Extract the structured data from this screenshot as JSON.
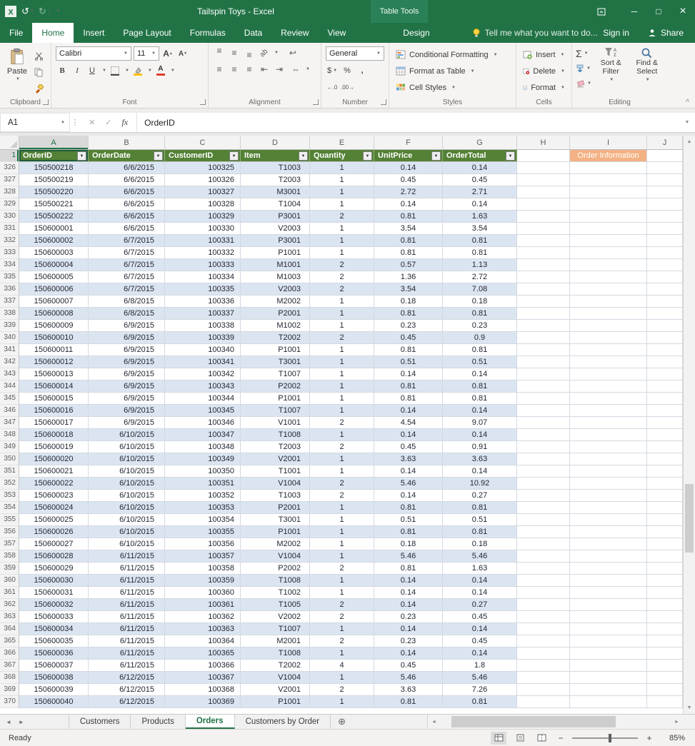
{
  "title_bar": {
    "title": "Tailspin Toys - Excel",
    "context_label": "Table Tools"
  },
  "icons": {
    "undo": "↺",
    "redo": "↻",
    "dropdown": "▼",
    "minimize": "─",
    "maximize": "□",
    "close": "×",
    "cancel": "✕",
    "enter": "✓",
    "insert_function": "fx",
    "vdots": "⋮",
    "expand_formula": "▼",
    "align_lines": "≡",
    "wrap": "↩",
    "orientation": "ab",
    "indent_dec": "⇤",
    "indent_inc": "⇥",
    "dec_decimal": "←.0",
    "inc_decimal": ".00→",
    "currency": "$",
    "percent": "%",
    "comma": ",",
    "autosum": "Σ",
    "collapse_ribbon": "^",
    "scroll_up": "▲",
    "scroll_down": "▼",
    "scroll_left": "◄",
    "scroll_right": "►",
    "prev_sheet": "◄",
    "next_sheet": "►",
    "add_sheet": "⊕",
    "zoom_out": "−",
    "zoom_in": "+",
    "increase_font": "▲",
    "decrease_font": "▼",
    "grow_a": "A",
    "shrink_a": "A",
    "font_color_a": "A",
    "merge": "⇔"
  },
  "ribbon": {
    "tabs": [
      {
        "label": "File",
        "file": true
      },
      {
        "label": "Home",
        "active": true
      },
      {
        "label": "Insert"
      },
      {
        "label": "Page Layout"
      },
      {
        "label": "Formulas"
      },
      {
        "label": "Data"
      },
      {
        "label": "Review"
      },
      {
        "label": "View"
      },
      {
        "label": "Design",
        "contextual": true
      }
    ],
    "tell_me": "Tell me what you want to do...",
    "sign_in": "Sign in",
    "share": "Share",
    "clipboard": {
      "label": "Clipboard",
      "paste": "Paste"
    },
    "font": {
      "label": "Font",
      "font_name": "Calibri",
      "font_size": "11",
      "bold": "B",
      "italic": "I",
      "underline": "U"
    },
    "alignment": {
      "label": "Alignment"
    },
    "number": {
      "label": "Number",
      "format": "General"
    },
    "styles": {
      "label": "Styles",
      "items": [
        "Conditional Formatting",
        "Format as Table",
        "Cell Styles"
      ]
    },
    "cells": {
      "label": "Cells",
      "items": [
        "Insert",
        "Delete",
        "Format"
      ]
    },
    "editing": {
      "label": "Editing",
      "sort_filter": "Sort & Filter",
      "find_select": "Find & Select"
    }
  },
  "formula_bar": {
    "name_box": "A1",
    "value": "OrderID"
  },
  "sheet": {
    "columns": [
      "A",
      "B",
      "C",
      "D",
      "E",
      "F",
      "G",
      "H",
      "I",
      "J"
    ],
    "selected_column": "A",
    "header_row_num": "1",
    "headers": [
      "OrderID",
      "OrderDate",
      "CustomerID",
      "Item",
      "Quantity",
      "UnitPrice",
      "OrderTotal"
    ],
    "extra_header": {
      "col": "I",
      "label": "Order Information"
    },
    "rows": [
      {
        "n": 326,
        "c": [
          "150500218",
          "6/6/2015",
          "100325",
          "T1003",
          "1",
          "0.14",
          "0.14"
        ]
      },
      {
        "n": 327,
        "c": [
          "150500219",
          "6/6/2015",
          "100326",
          "T2003",
          "1",
          "0.45",
          "0.45"
        ]
      },
      {
        "n": 328,
        "c": [
          "150500220",
          "6/6/2015",
          "100327",
          "M3001",
          "1",
          "2.72",
          "2.71"
        ]
      },
      {
        "n": 329,
        "c": [
          "150500221",
          "6/6/2015",
          "100328",
          "T1004",
          "1",
          "0.14",
          "0.14"
        ]
      },
      {
        "n": 330,
        "c": [
          "150500222",
          "6/6/2015",
          "100329",
          "P3001",
          "2",
          "0.81",
          "1.63"
        ]
      },
      {
        "n": 331,
        "c": [
          "150600001",
          "6/6/2015",
          "100330",
          "V2003",
          "1",
          "3.54",
          "3.54"
        ]
      },
      {
        "n": 332,
        "c": [
          "150600002",
          "6/7/2015",
          "100331",
          "P3001",
          "1",
          "0.81",
          "0.81"
        ]
      },
      {
        "n": 333,
        "c": [
          "150600003",
          "6/7/2015",
          "100332",
          "P1001",
          "1",
          "0.81",
          "0.81"
        ]
      },
      {
        "n": 334,
        "c": [
          "150600004",
          "6/7/2015",
          "100333",
          "M1001",
          "2",
          "0.57",
          "1.13"
        ]
      },
      {
        "n": 335,
        "c": [
          "150600005",
          "6/7/2015",
          "100334",
          "M1003",
          "2",
          "1.36",
          "2.72"
        ]
      },
      {
        "n": 336,
        "c": [
          "150600006",
          "6/7/2015",
          "100335",
          "V2003",
          "2",
          "3.54",
          "7.08"
        ]
      },
      {
        "n": 337,
        "c": [
          "150600007",
          "6/8/2015",
          "100336",
          "M2002",
          "1",
          "0.18",
          "0.18"
        ]
      },
      {
        "n": 338,
        "c": [
          "150600008",
          "6/8/2015",
          "100337",
          "P2001",
          "1",
          "0.81",
          "0.81"
        ]
      },
      {
        "n": 339,
        "c": [
          "150600009",
          "6/9/2015",
          "100338",
          "M1002",
          "1",
          "0.23",
          "0.23"
        ]
      },
      {
        "n": 340,
        "c": [
          "150600010",
          "6/9/2015",
          "100339",
          "T2002",
          "2",
          "0.45",
          "0.9"
        ]
      },
      {
        "n": 341,
        "c": [
          "150600011",
          "6/9/2015",
          "100340",
          "P1001",
          "1",
          "0.81",
          "0.81"
        ]
      },
      {
        "n": 342,
        "c": [
          "150600012",
          "6/9/2015",
          "100341",
          "T3001",
          "1",
          "0.51",
          "0.51"
        ]
      },
      {
        "n": 343,
        "c": [
          "150600013",
          "6/9/2015",
          "100342",
          "T1007",
          "1",
          "0.14",
          "0.14"
        ]
      },
      {
        "n": 344,
        "c": [
          "150600014",
          "6/9/2015",
          "100343",
          "P2002",
          "1",
          "0.81",
          "0.81"
        ]
      },
      {
        "n": 345,
        "c": [
          "150600015",
          "6/9/2015",
          "100344",
          "P1001",
          "1",
          "0.81",
          "0.81"
        ]
      },
      {
        "n": 346,
        "c": [
          "150600016",
          "6/9/2015",
          "100345",
          "T1007",
          "1",
          "0.14",
          "0.14"
        ]
      },
      {
        "n": 347,
        "c": [
          "150600017",
          "6/9/2015",
          "100346",
          "V1001",
          "2",
          "4.54",
          "9.07"
        ]
      },
      {
        "n": 348,
        "c": [
          "150600018",
          "6/10/2015",
          "100347",
          "T1008",
          "1",
          "0.14",
          "0.14"
        ]
      },
      {
        "n": 349,
        "c": [
          "150600019",
          "6/10/2015",
          "100348",
          "T2003",
          "2",
          "0.45",
          "0.91"
        ]
      },
      {
        "n": 350,
        "c": [
          "150600020",
          "6/10/2015",
          "100349",
          "V2001",
          "1",
          "3.63",
          "3.63"
        ]
      },
      {
        "n": 351,
        "c": [
          "150600021",
          "6/10/2015",
          "100350",
          "T1001",
          "1",
          "0.14",
          "0.14"
        ]
      },
      {
        "n": 352,
        "c": [
          "150600022",
          "6/10/2015",
          "100351",
          "V1004",
          "2",
          "5.46",
          "10.92"
        ]
      },
      {
        "n": 353,
        "c": [
          "150600023",
          "6/10/2015",
          "100352",
          "T1003",
          "2",
          "0.14",
          "0.27"
        ]
      },
      {
        "n": 354,
        "c": [
          "150600024",
          "6/10/2015",
          "100353",
          "P2001",
          "1",
          "0.81",
          "0.81"
        ]
      },
      {
        "n": 355,
        "c": [
          "150600025",
          "6/10/2015",
          "100354",
          "T3001",
          "1",
          "0.51",
          "0.51"
        ]
      },
      {
        "n": 356,
        "c": [
          "150600026",
          "6/10/2015",
          "100355",
          "P1001",
          "1",
          "0.81",
          "0.81"
        ]
      },
      {
        "n": 357,
        "c": [
          "150600027",
          "6/10/2015",
          "100356",
          "M2002",
          "1",
          "0.18",
          "0.18"
        ]
      },
      {
        "n": 358,
        "c": [
          "150600028",
          "6/11/2015",
          "100357",
          "V1004",
          "1",
          "5.46",
          "5.46"
        ]
      },
      {
        "n": 359,
        "c": [
          "150600029",
          "6/11/2015",
          "100358",
          "P2002",
          "2",
          "0.81",
          "1.63"
        ]
      },
      {
        "n": 360,
        "c": [
          "150600030",
          "6/11/2015",
          "100359",
          "T1008",
          "1",
          "0.14",
          "0.14"
        ]
      },
      {
        "n": 361,
        "c": [
          "150600031",
          "6/11/2015",
          "100360",
          "T1002",
          "1",
          "0.14",
          "0.14"
        ]
      },
      {
        "n": 362,
        "c": [
          "150600032",
          "6/11/2015",
          "100361",
          "T1005",
          "2",
          "0.14",
          "0.27"
        ]
      },
      {
        "n": 363,
        "c": [
          "150600033",
          "6/11/2015",
          "100362",
          "V2002",
          "2",
          "0.23",
          "0.45"
        ]
      },
      {
        "n": 364,
        "c": [
          "150600034",
          "6/11/2015",
          "100363",
          "T1007",
          "1",
          "0.14",
          "0.14"
        ]
      },
      {
        "n": 365,
        "c": [
          "150600035",
          "6/11/2015",
          "100364",
          "M2001",
          "2",
          "0.23",
          "0.45"
        ]
      },
      {
        "n": 366,
        "c": [
          "150600036",
          "6/11/2015",
          "100365",
          "T1008",
          "1",
          "0.14",
          "0.14"
        ]
      },
      {
        "n": 367,
        "c": [
          "150600037",
          "6/11/2015",
          "100366",
          "T2002",
          "4",
          "0.45",
          "1.8"
        ]
      },
      {
        "n": 368,
        "c": [
          "150600038",
          "6/12/2015",
          "100367",
          "V1004",
          "1",
          "5.46",
          "5.46"
        ]
      },
      {
        "n": 369,
        "c": [
          "150600039",
          "6/12/2015",
          "100368",
          "V2001",
          "2",
          "3.63",
          "7.26"
        ]
      },
      {
        "n": 370,
        "c": [
          "150600040",
          "6/12/2015",
          "100369",
          "P1001",
          "1",
          "0.81",
          "0.81"
        ]
      }
    ]
  },
  "sheet_tabs": {
    "tabs": [
      {
        "label": "Customers"
      },
      {
        "label": "Products"
      },
      {
        "label": "Orders",
        "active": true
      },
      {
        "label": "Customers by Order"
      }
    ]
  },
  "status_bar": {
    "mode": "Ready",
    "zoom": "85%"
  }
}
